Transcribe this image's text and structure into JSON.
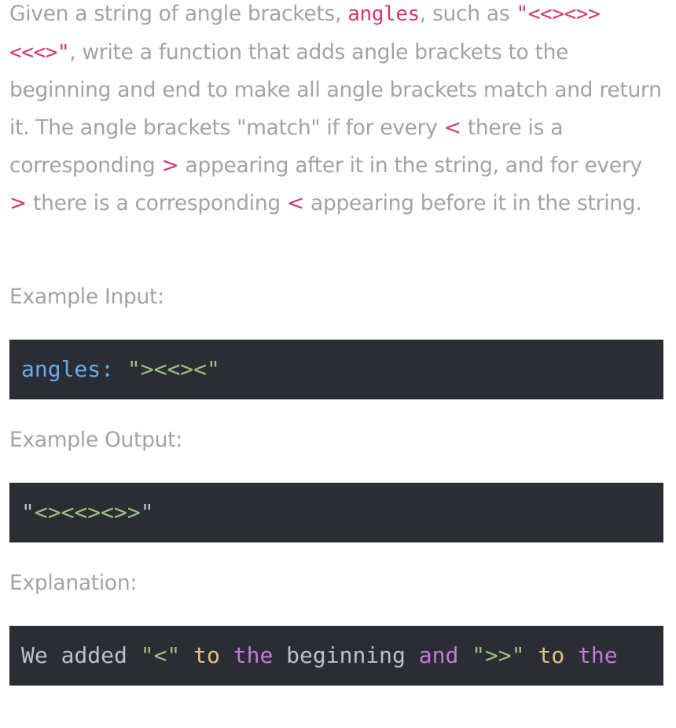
{
  "problem": {
    "intro": "Given a string of angle brackets, ",
    "param_name": "angles",
    "such_as": ", such as ",
    "example_string": "\"<<><>><<<>\"",
    "after_example": ", write a function that adds angle brackets to the beginning and end to make all angle brackets match and return it. The angle brackets \"match\" if for every ",
    "open_bracket": "<",
    "mid1": " there is a corresponding ",
    "close_bracket": ">",
    "mid2": " appearing after it in the string, and for every ",
    "close_bracket_2": ">",
    "mid3": " there is a corresponding ",
    "open_bracket_2": "<",
    "end": " appearing before it in the string."
  },
  "example_input": {
    "label": "Example Input:",
    "key": "angles:",
    "value": "\"><<><\""
  },
  "example_output": {
    "label": "Example Output:",
    "quote_open": "\"",
    "value": "<><<><>>",
    "quote_close": "\""
  },
  "explanation": {
    "label": "Explanation:",
    "tokens": [
      {
        "text": "We added ",
        "kind": "plain"
      },
      {
        "text": "\"<\"",
        "kind": "str"
      },
      {
        "text": " ",
        "kind": "plain"
      },
      {
        "text": "to",
        "kind": "kw"
      },
      {
        "text": " ",
        "kind": "plain"
      },
      {
        "text": "the",
        "kind": "kw2"
      },
      {
        "text": " beginning ",
        "kind": "plain"
      },
      {
        "text": "and",
        "kind": "kw2"
      },
      {
        "text": " ",
        "kind": "plain"
      },
      {
        "text": "\">>\"",
        "kind": "str"
      },
      {
        "text": " ",
        "kind": "plain"
      },
      {
        "text": "to",
        "kind": "kw"
      },
      {
        "text": " ",
        "kind": "plain"
      },
      {
        "text": "the",
        "kind": "kw2"
      }
    ]
  },
  "colors": {
    "text": "#a3a3a3",
    "inline_code": "#d33969",
    "code_bg": "#2b2d35",
    "code_key": "#64acee",
    "code_string": "#98c379",
    "code_keyword_yellow": "#e5c07b",
    "code_keyword_purple": "#c678dd",
    "code_plain": "#bdc1c8"
  }
}
